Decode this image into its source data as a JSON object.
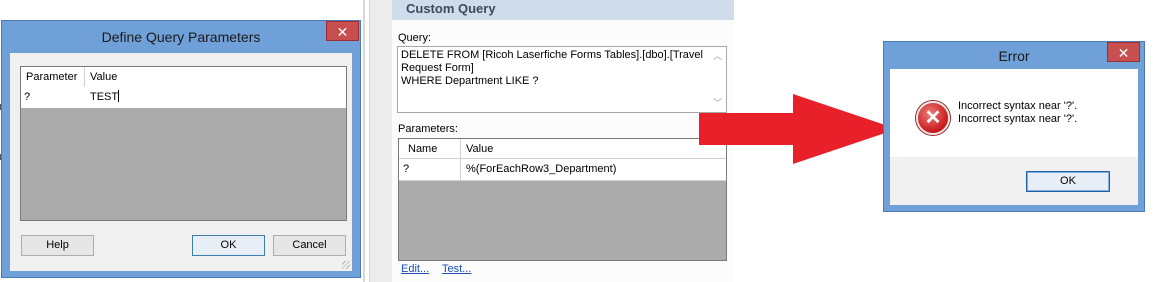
{
  "define_dialog": {
    "title": "Define Query Parameters",
    "close_glyph": "✕",
    "columns": [
      "Parameter",
      "Value"
    ],
    "rows": [
      {
        "parameter": "?",
        "value": "TEST"
      }
    ],
    "buttons": {
      "help": "Help",
      "ok": "OK",
      "cancel": "Cancel"
    }
  },
  "custom_query": {
    "header": "Custom Query",
    "query_label": "Query:",
    "query_lines": [
      "DELETE FROM [Ricoh Laserfiche Forms Tables].[dbo].[Travel",
      "Request Form]",
      "WHERE  Department LIKE ?"
    ],
    "parameters_label": "Parameters:",
    "columns": [
      "Name",
      "Value"
    ],
    "rows": [
      {
        "name": "?",
        "value": "%(ForEachRow3_Department)"
      }
    ],
    "links": {
      "edit": "Edit...",
      "test": "Test..."
    }
  },
  "error_dialog": {
    "title": "Error",
    "close_glyph": "✕",
    "icon_glyph": "✕",
    "message_lines": [
      "Incorrect syntax near '?'.",
      "Incorrect syntax near '?'."
    ],
    "ok_button": "OK"
  },
  "colors": {
    "title_bar": "#6fa0d8",
    "close_button": "#c74f4f",
    "arrow": "#e8202a",
    "panel_header": "#cfdcec",
    "link": "#1a4fb5"
  }
}
